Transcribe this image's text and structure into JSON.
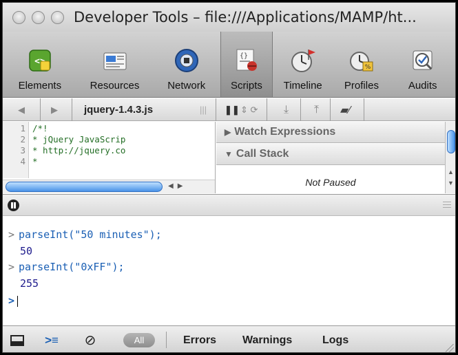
{
  "window": {
    "title": "Developer Tools – file:///Applications/MAMP/ht..."
  },
  "toolbar": {
    "items": [
      {
        "label": "Elements",
        "icon": "elements-icon"
      },
      {
        "label": "Resources",
        "icon": "resources-icon"
      },
      {
        "label": "Network",
        "icon": "network-icon"
      },
      {
        "label": "Scripts",
        "icon": "scripts-icon",
        "active": true
      },
      {
        "label": "Timeline",
        "icon": "timeline-icon"
      },
      {
        "label": "Profiles",
        "icon": "profiles-icon"
      },
      {
        "label": "Audits",
        "icon": "audits-icon"
      }
    ]
  },
  "scripts_bar": {
    "back": "◀",
    "forward": "▶",
    "file": "jquery-1.4.3.js"
  },
  "source": {
    "lines": [
      {
        "num": "1",
        "text": "/*!"
      },
      {
        "num": "2",
        "text": " * jQuery JavaScrip"
      },
      {
        "num": "3",
        "text": " * http://jquery.co"
      },
      {
        "num": "4",
        "text": " *"
      }
    ]
  },
  "side_panes": {
    "watch": "Watch Expressions",
    "callstack": "Call Stack",
    "status": "Not Paused"
  },
  "console": {
    "entries": [
      {
        "command": "parseInt(\"50 minutes\");",
        "result": "50"
      },
      {
        "command": "parseInt(\"0xFF\");",
        "result": "255"
      }
    ],
    "prompt": ">"
  },
  "statusbar": {
    "all": "All",
    "errors": "Errors",
    "warnings": "Warnings",
    "logs": "Logs"
  },
  "colors": {
    "command": "#1a5fb4",
    "result": "#1d1a8c",
    "comment": "#236e25",
    "scroll_thumb": "#4a93e8"
  }
}
